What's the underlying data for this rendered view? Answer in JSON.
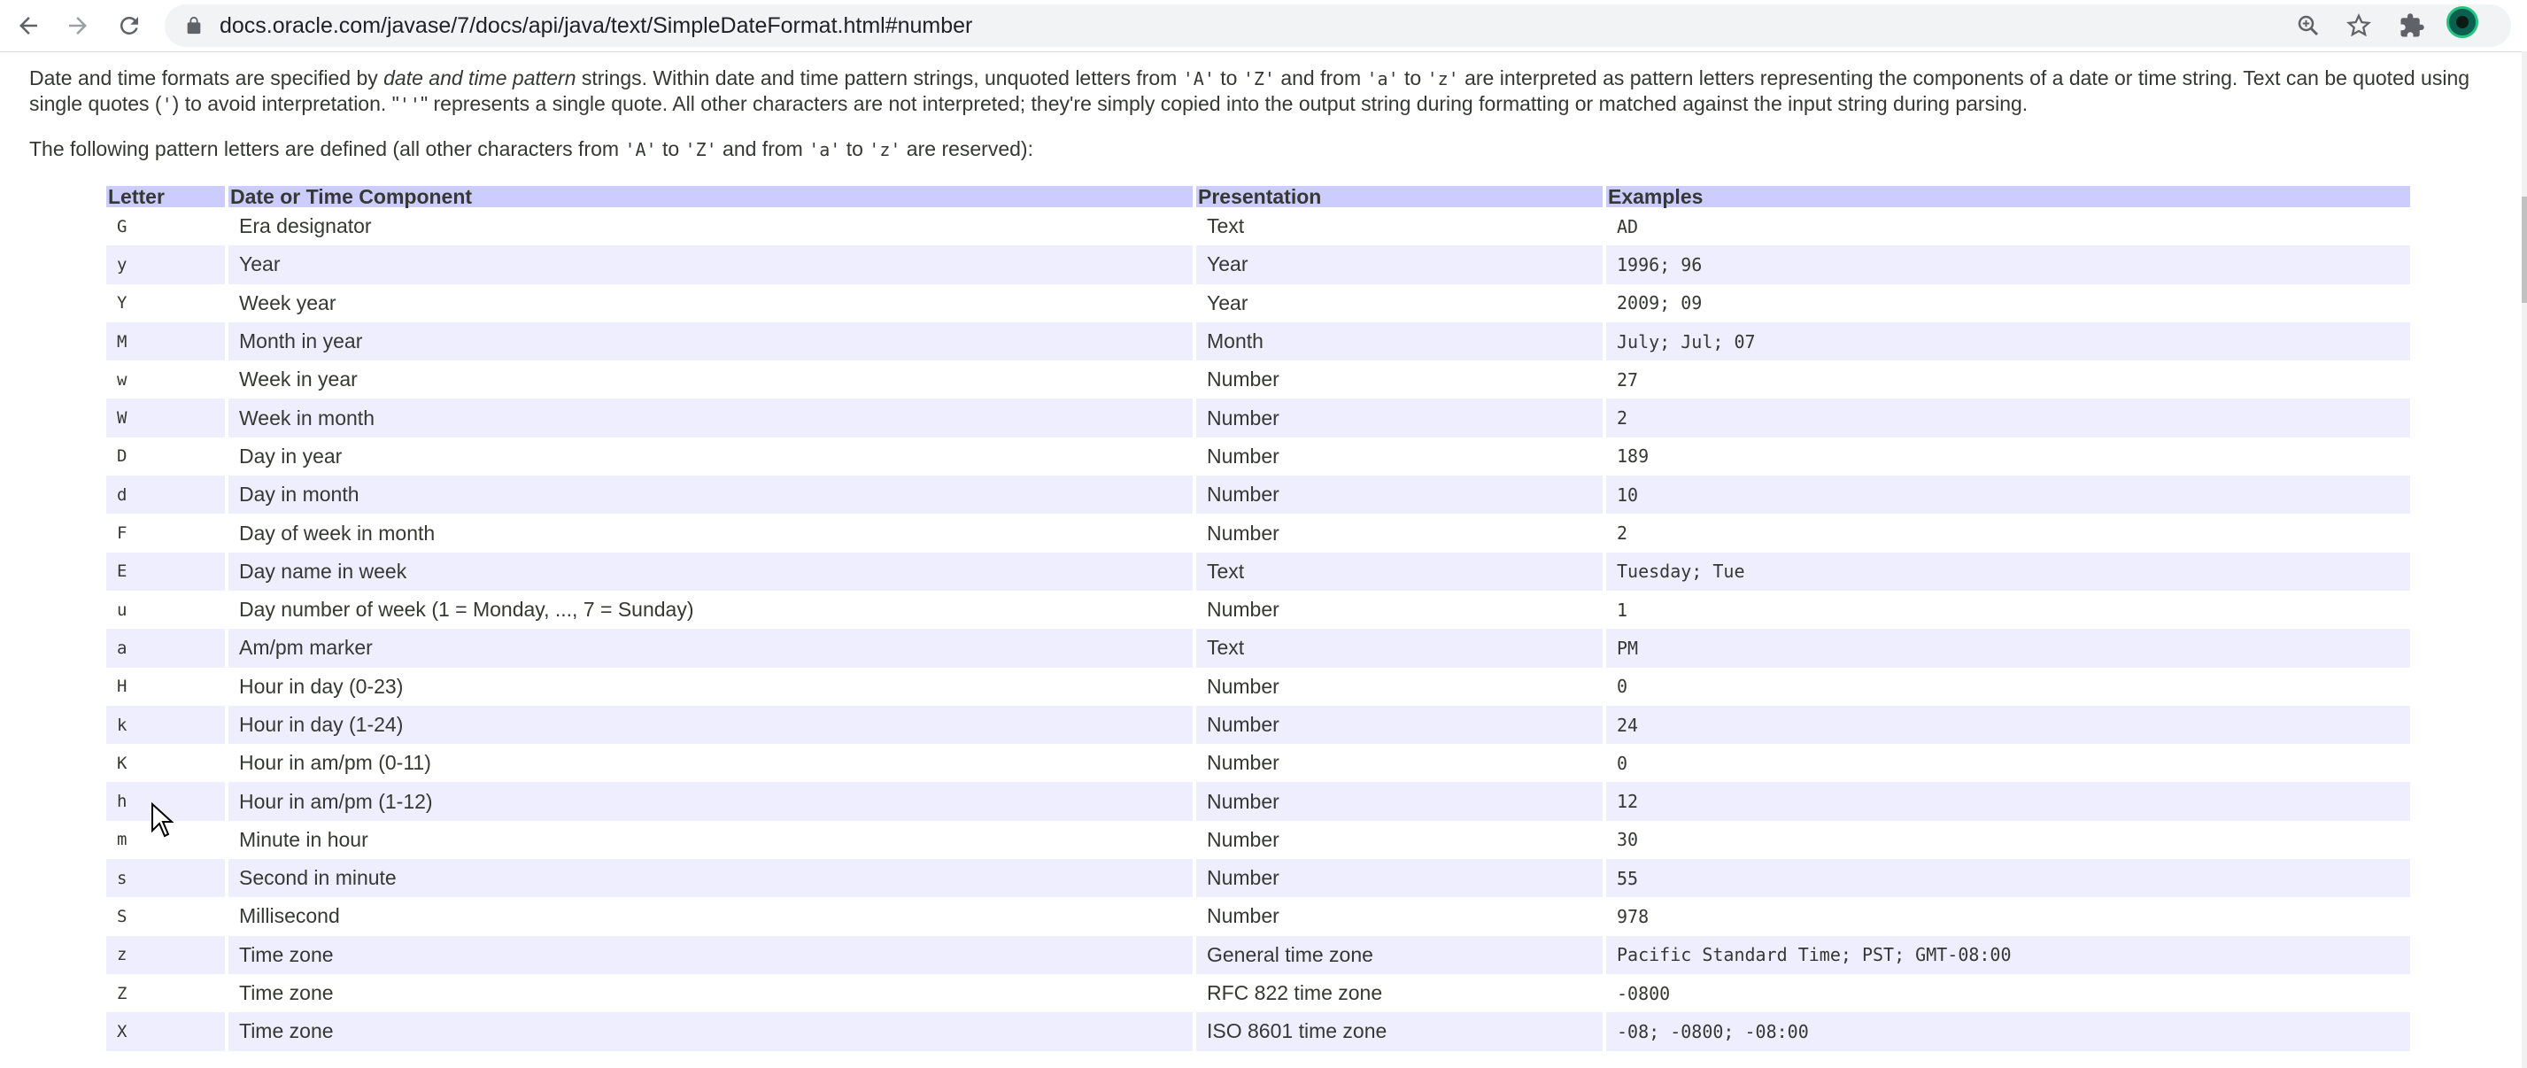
{
  "browser": {
    "url": "docs.oracle.com/javase/7/docs/api/java/text/SimpleDateFormat.html#number",
    "icons": [
      "back-arrow-icon",
      "forward-arrow-icon",
      "reload-icon",
      "lock-icon",
      "zoom-icon",
      "star-icon",
      "extensions-icon",
      "profile-avatar"
    ]
  },
  "intro": {
    "line1_a": "Date and time formats are specified by ",
    "line1_em": "date and time pattern",
    "line1_b": " strings. Within date and time pattern strings, unquoted letters from ",
    "code_A": "'A'",
    "to1": " to ",
    "code_Z": "'Z'",
    "and_from": " and from ",
    "code_a": "'a'",
    "to2": " to ",
    "code_z": "'z'",
    "line1_c": " are interpreted as pattern letters representing the components of a date or time string. Text can be quoted using single quotes (",
    "code_quote": "'",
    "line1_d": ") to avoid interpretation. \"",
    "code_dquote": "''",
    "line1_e": "\" represents a single quote. All other characters are not interpreted; they're simply copied into the output string during formatting or matched against the input string during parsing."
  },
  "reserved": {
    "a": "The following pattern letters are defined (all other characters from ",
    "code_A": "'A'",
    "b": " to ",
    "code_Z": "'Z'",
    "c": " and from ",
    "code_a": "'a'",
    "d": " to ",
    "code_z": "'z'",
    "e": " are reserved):"
  },
  "table": {
    "headers": [
      "Letter",
      "Date or Time Component",
      "Presentation",
      "Examples"
    ],
    "rows": [
      {
        "letter": "G",
        "component": "Era designator",
        "presentation": "Text",
        "example": "AD"
      },
      {
        "letter": "y",
        "component": "Year",
        "presentation": "Year",
        "example": "1996; 96"
      },
      {
        "letter": "Y",
        "component": "Week year",
        "presentation": "Year",
        "example": "2009; 09"
      },
      {
        "letter": "M",
        "component": "Month in year",
        "presentation": "Month",
        "example": "July; Jul; 07"
      },
      {
        "letter": "w",
        "component": "Week in year",
        "presentation": "Number",
        "example": "27"
      },
      {
        "letter": "W",
        "component": "Week in month",
        "presentation": "Number",
        "example": "2"
      },
      {
        "letter": "D",
        "component": "Day in year",
        "presentation": "Number",
        "example": "189"
      },
      {
        "letter": "d",
        "component": "Day in month",
        "presentation": "Number",
        "example": "10"
      },
      {
        "letter": "F",
        "component": "Day of week in month",
        "presentation": "Number",
        "example": "2"
      },
      {
        "letter": "E",
        "component": "Day name in week",
        "presentation": "Text",
        "example": "Tuesday; Tue"
      },
      {
        "letter": "u",
        "component": "Day number of week (1 = Monday, ..., 7 = Sunday)",
        "presentation": "Number",
        "example": "1"
      },
      {
        "letter": "a",
        "component": "Am/pm marker",
        "presentation": "Text",
        "example": "PM"
      },
      {
        "letter": "H",
        "component": "Hour in day (0-23)",
        "presentation": "Number",
        "example": "0"
      },
      {
        "letter": "k",
        "component": "Hour in day (1-24)",
        "presentation": "Number",
        "example": "24"
      },
      {
        "letter": "K",
        "component": "Hour in am/pm (0-11)",
        "presentation": "Number",
        "example": "0"
      },
      {
        "letter": "h",
        "component": "Hour in am/pm (1-12)",
        "presentation": "Number",
        "example": "12"
      },
      {
        "letter": "m",
        "component": "Minute in hour",
        "presentation": "Number",
        "example": "30"
      },
      {
        "letter": "s",
        "component": "Second in minute",
        "presentation": "Number",
        "example": "55"
      },
      {
        "letter": "S",
        "component": "Millisecond",
        "presentation": "Number",
        "example": "978"
      },
      {
        "letter": "z",
        "component": "Time zone",
        "presentation": "General time zone",
        "example": "Pacific Standard Time; PST; GMT-08:00"
      },
      {
        "letter": "Z",
        "component": "Time zone",
        "presentation": "RFC 822 time zone",
        "example": "-0800"
      },
      {
        "letter": "X",
        "component": "Time zone",
        "presentation": "ISO 8601 time zone",
        "example": "-08; -0800; -08:00"
      }
    ]
  },
  "colors": {
    "header_bg": "#ccccff",
    "alt_row_bg": "#eeeeff",
    "text": "#353833"
  }
}
